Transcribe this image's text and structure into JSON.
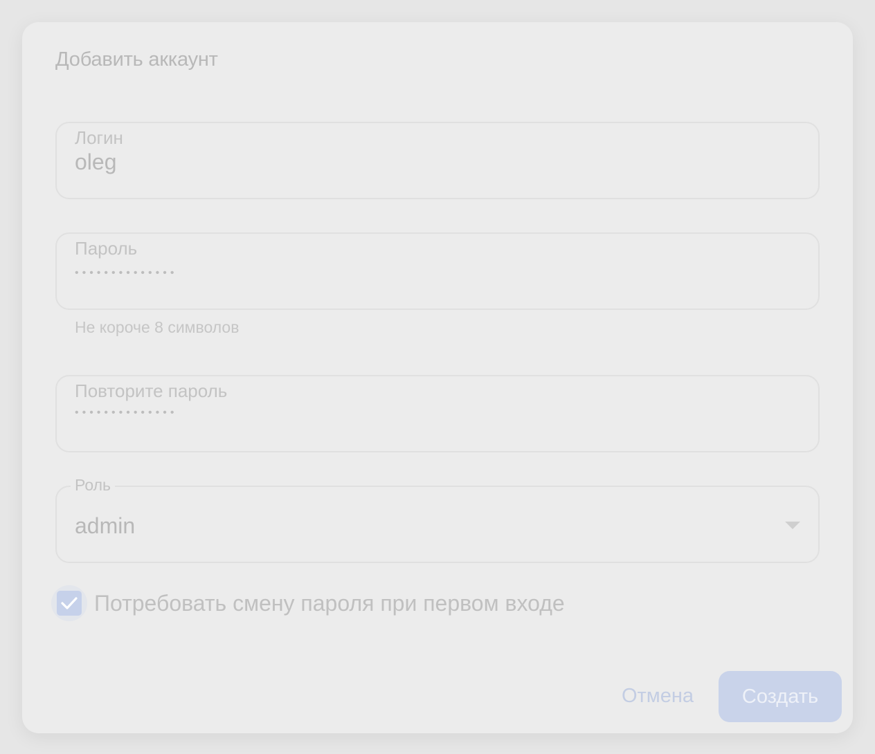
{
  "dialog": {
    "title": "Добавить аккаунт"
  },
  "login": {
    "label": "Логин",
    "value": "oleg"
  },
  "password": {
    "label": "Пароль",
    "masked_value": "••••••••••••••",
    "helper": "Не короче 8 символов"
  },
  "repeat_password": {
    "label": "Повторите пароль",
    "masked_value": "••••••••••••••"
  },
  "role": {
    "label": "Роль",
    "selected": "admin"
  },
  "require_change": {
    "label": "Потребовать смену пароля при первом входе",
    "checked": true
  },
  "actions": {
    "cancel_label": "Отмена",
    "create_label": "Создать"
  },
  "colors": {
    "accent": "#c9d3ea",
    "background": "#ececec"
  }
}
